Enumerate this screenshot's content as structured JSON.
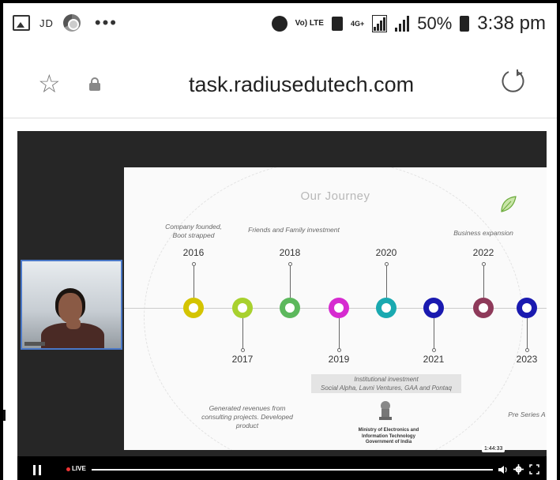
{
  "status_bar": {
    "carrier": "JD",
    "volte": "Vo) LTE",
    "network": "4G+",
    "battery_pct": "50%",
    "time": "3:38 pm"
  },
  "browser": {
    "url": "task.radiusedutech.com"
  },
  "slide": {
    "title": "Our Journey",
    "milestones": [
      {
        "year": "2016",
        "color": "#d4c400",
        "note": "Company founded, Boot strapped",
        "position": "top"
      },
      {
        "year": "2017",
        "color": "#a8d12e",
        "note": "Generated revenues from consulting projects. Developed product",
        "position": "bottom"
      },
      {
        "year": "2018",
        "color": "#5cb85c",
        "note": "Friends and Family investment",
        "position": "top"
      },
      {
        "year": "2019",
        "color": "#d62bd0",
        "note": "",
        "position": "bottom"
      },
      {
        "year": "2020",
        "color": "#1aa9b0",
        "note": "",
        "position": "top"
      },
      {
        "year": "2021",
        "color": "#1a1ab0",
        "note": "",
        "position": "bottom"
      },
      {
        "year": "2022",
        "color": "#8e3a5a",
        "note": "Business expansion",
        "position": "top"
      },
      {
        "year": "2023",
        "color": "#1a1ab0",
        "note": "Pre Series A",
        "position": "bottom"
      }
    ],
    "investment_line1": "Institutional investment",
    "investment_line2": "Social Alpha, Lavni Ventures, GAA and Pontaq",
    "ministry_line1": "Ministry of Electronics and",
    "ministry_line2": "Information Technology",
    "ministry_line3": "Government of India"
  },
  "player": {
    "live_label": "LIVE",
    "time_tooltip": "1:44:33",
    "state": "playing"
  }
}
